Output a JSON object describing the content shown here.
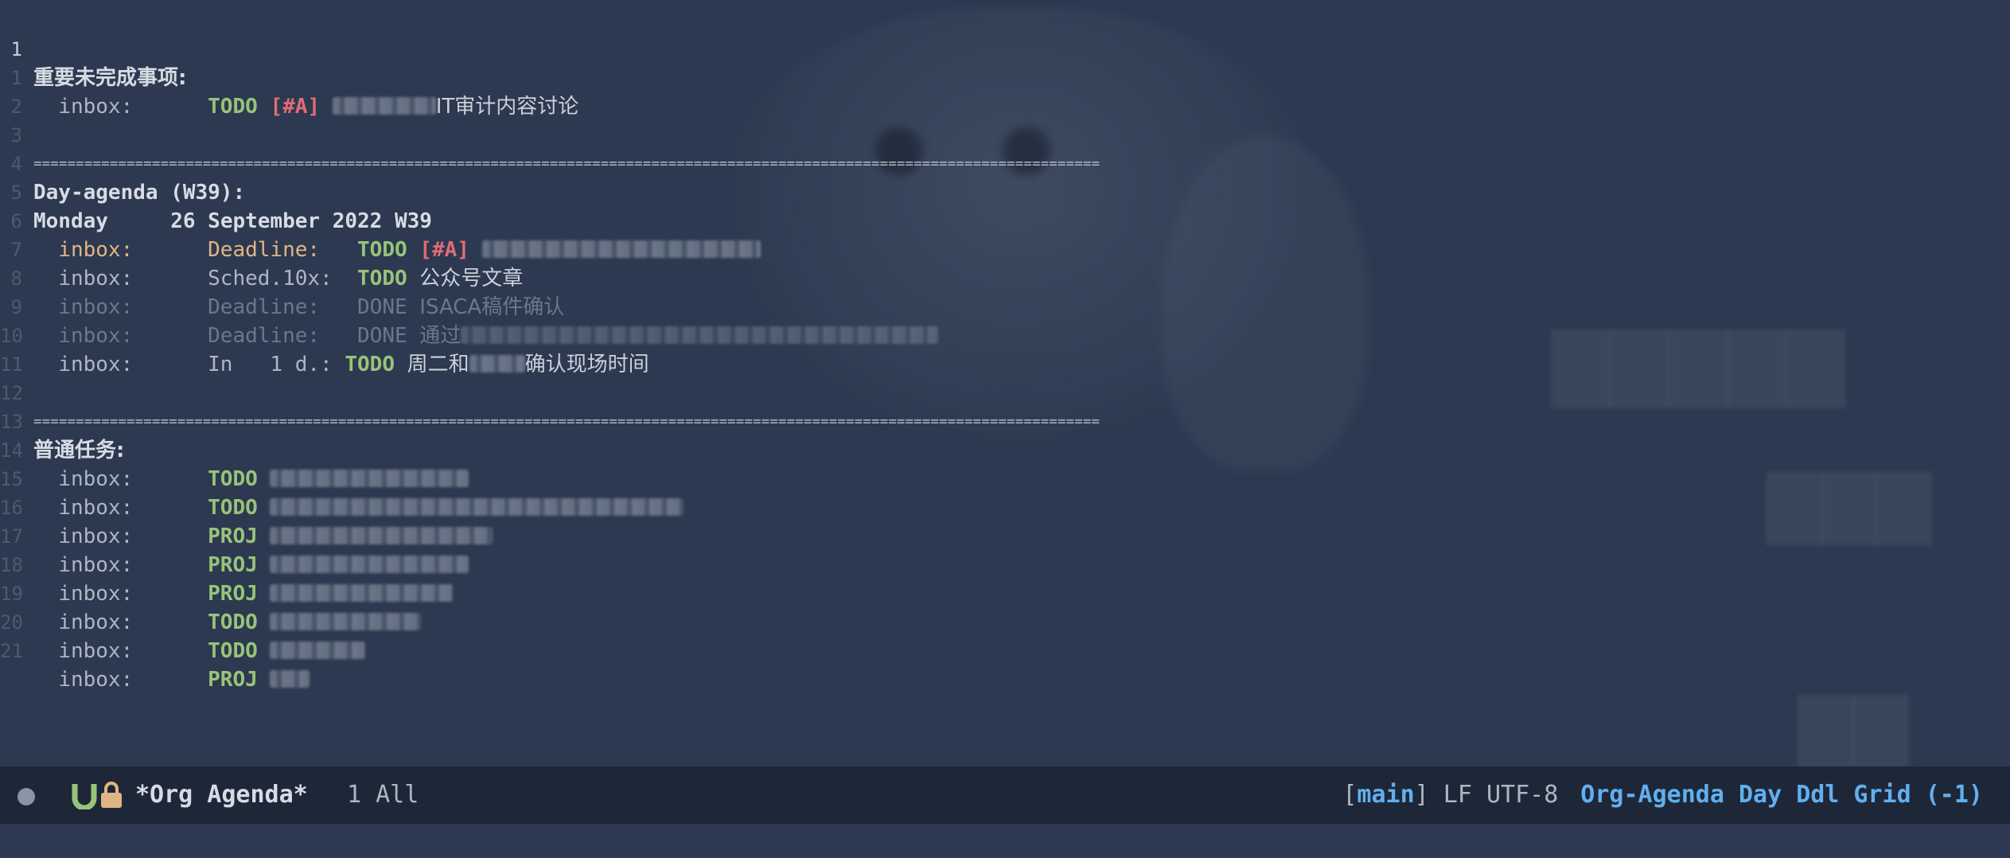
{
  "buffer": {
    "lines": [
      {
        "num": "1",
        "text": "重要未完成事项:"
      },
      {
        "num": "1",
        "category": "inbox:",
        "keyword": "TODO",
        "priority": "[#A]",
        "task": "IT审计内容讨论"
      },
      {
        "num": "2"
      },
      {
        "num": "3",
        "separator": "=============================================================================================================================="
      },
      {
        "num": "4",
        "text": "Day-agenda (W39):"
      },
      {
        "num": "5",
        "day": "Monday",
        "date": "26 September 2022 W39"
      },
      {
        "num": "6",
        "category": "inbox:",
        "sched": "Deadline:",
        "keyword": "TODO",
        "priority": "[#A]"
      },
      {
        "num": "7",
        "category": "inbox:",
        "sched": "Sched.10x:",
        "keyword": "TODO",
        "task": "公众号文章"
      },
      {
        "num": "8",
        "category": "inbox:",
        "sched": "Deadline:",
        "keyword": "DONE",
        "task": "ISACA稿件确认"
      },
      {
        "num": "9",
        "category": "inbox:",
        "sched": "Deadline:",
        "keyword": "DONE",
        "task": "通过"
      },
      {
        "num": "10",
        "category": "inbox:",
        "sched": "In   1 d.:",
        "keyword": "TODO",
        "task_prefix": "周二和",
        "task_suffix": "确认现场时间"
      },
      {
        "num": "11"
      },
      {
        "num": "12",
        "separator": "=============================================================================================================================="
      },
      {
        "num": "13",
        "text": "普通任务:"
      },
      {
        "num": "14",
        "category": "inbox:",
        "keyword": "TODO"
      },
      {
        "num": "15",
        "category": "inbox:",
        "keyword": "TODO"
      },
      {
        "num": "16",
        "category": "inbox:",
        "keyword": "PROJ"
      },
      {
        "num": "17",
        "category": "inbox:",
        "keyword": "PROJ"
      },
      {
        "num": "18",
        "category": "inbox:",
        "keyword": "PROJ"
      },
      {
        "num": "19",
        "category": "inbox:",
        "keyword": "TODO"
      },
      {
        "num": "20",
        "category": "inbox:",
        "keyword": "TODO"
      },
      {
        "num": "21",
        "category": "inbox:",
        "keyword": "PROJ"
      }
    ]
  },
  "modeline": {
    "buffer_name": "*Org Agenda*",
    "position": "1 All",
    "branch_open": "[",
    "branch": "main",
    "branch_close": "]",
    "encoding": "LF UTF-8",
    "major_mode": "Org-Agenda Day Ddl Grid (-1)"
  },
  "colors": {
    "background": "#2c3950",
    "todo": "#98c379",
    "priority": "#e06c75",
    "deadline": "#e0b585",
    "modeline_accent": "#61afef"
  },
  "icons": [
    "unsaved-indicator-icon",
    "u-logo-icon",
    "lock-icon"
  ]
}
